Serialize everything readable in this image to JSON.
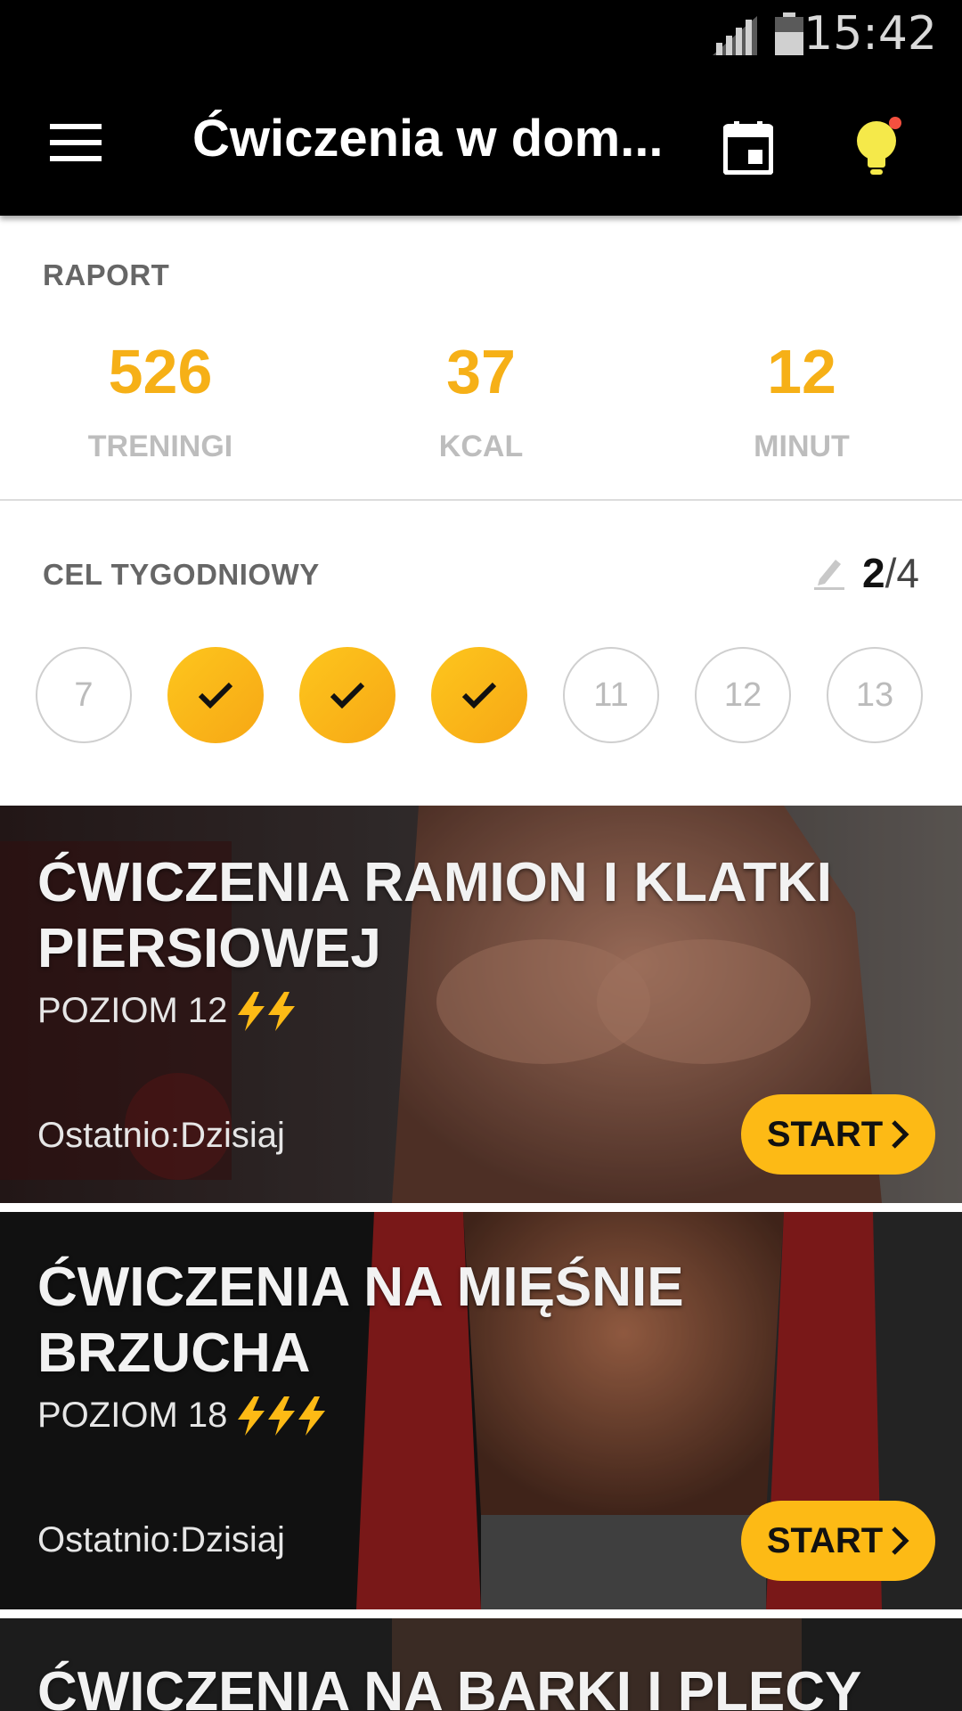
{
  "status_bar": {
    "time": "15:42"
  },
  "toolbar": {
    "title": "Ćwiczenia w dom...",
    "icons": {
      "menu": "menu-icon",
      "calendar": "calendar-icon",
      "tips": "lightbulb-icon"
    },
    "tips_notification": true
  },
  "report": {
    "label": "RAPORT",
    "stats": [
      {
        "value": "526",
        "label": "TRENINGI"
      },
      {
        "value": "37",
        "label": "KCAL"
      },
      {
        "value": "12",
        "label": "MINUT"
      }
    ]
  },
  "weekly_goal": {
    "label": "CEL TYGODNIOWY",
    "done": "2",
    "separator": "/",
    "total": "4",
    "days": [
      {
        "label": "7",
        "checked": false
      },
      {
        "label": "",
        "checked": true
      },
      {
        "label": "",
        "checked": true
      },
      {
        "label": "",
        "checked": true
      },
      {
        "label": "11",
        "checked": false
      },
      {
        "label": "12",
        "checked": false
      },
      {
        "label": "13",
        "checked": false
      }
    ]
  },
  "workouts": [
    {
      "title": "ĆWICZENIA RAMION I KLATKI PIERSIOWEJ",
      "level": "POZIOM 12",
      "bolts": 2,
      "last": "Ostatnio:Dzisiaj",
      "start": "START"
    },
    {
      "title": "ĆWICZENIA NA MIĘŚNIE BRZUCHA",
      "level": "POZIOM 18",
      "bolts": 3,
      "last": "Ostatnio:Dzisiaj",
      "start": "START"
    },
    {
      "title": "ĆWICZENIA NA BARKI I PLECY"
    }
  ],
  "colors": {
    "accent": "#f6b017",
    "button": "#fdba15",
    "toolbar": "#000000"
  }
}
